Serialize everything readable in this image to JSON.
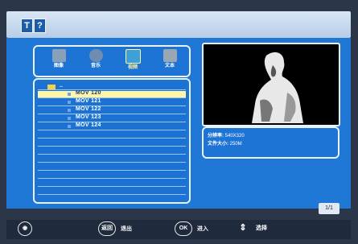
{
  "topbar": {
    "icon1": "T",
    "icon2": "?"
  },
  "categories": [
    {
      "label": "图像",
      "icon": "photo-icon",
      "color": "#8aa0b8"
    },
    {
      "label": "音乐",
      "icon": "music-icon",
      "color": "#6e8db1"
    },
    {
      "label": "视频",
      "icon": "video-icon",
      "color": "#3fa0d8"
    },
    {
      "label": "文本",
      "icon": "text-icon",
      "color": "#9aa7b3"
    }
  ],
  "list": {
    "up_label": "..",
    "items": [
      {
        "name": "MOV 120",
        "selected": true
      },
      {
        "name": "MOV 121",
        "selected": false
      },
      {
        "name": "MOV 122",
        "selected": false
      },
      {
        "name": "MOV 123",
        "selected": false
      },
      {
        "name": "MOV 124",
        "selected": false
      }
    ]
  },
  "info": {
    "resolution_label": "分辨率:",
    "resolution_value": "540X320",
    "size_label": "文件大小:",
    "size_value": "250M"
  },
  "page": "1/1",
  "bottom": {
    "return_key": "返回",
    "return_label": "退出",
    "ok_key": "OK",
    "ok_label": "进入",
    "move_label": "选择"
  }
}
